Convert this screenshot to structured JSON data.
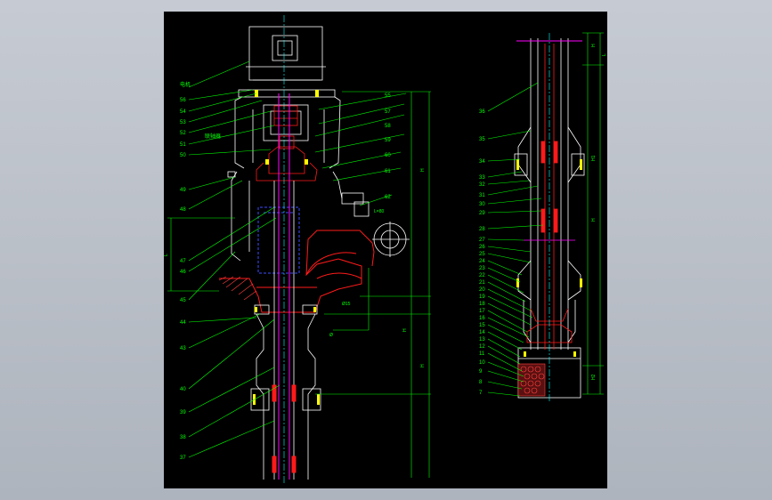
{
  "colors": {
    "background": "#b8bec7",
    "canvas": "#000000",
    "outline": "#ffffff",
    "leader": "#00ff00",
    "section": "#ff1a1a",
    "shaft": "#ff00ff",
    "centerline": "#00ffff",
    "hidden": "#3b4bff",
    "bolt": "#ffff00",
    "hatch": "#ff4040"
  },
  "left_view": {
    "part_labels": [
      "56",
      "54",
      "53",
      "52",
      "51",
      "50",
      "49",
      "48",
      "47",
      "46",
      "45",
      "44",
      "43",
      "40",
      "39",
      "38",
      "37"
    ],
    "side_labels": [
      "55",
      "57",
      "58",
      "59",
      "60",
      "61",
      "62"
    ],
    "motor_tag": "电机",
    "coupling_tag": "联轴器",
    "dimensions": [
      "L",
      "H",
      "Ø",
      "Ø15",
      "L=80"
    ]
  },
  "right_view": {
    "part_labels": [
      "36",
      "35",
      "34",
      "33",
      "32",
      "31",
      "30",
      "29",
      "28",
      "27",
      "26",
      "25",
      "24",
      "23",
      "22",
      "21",
      "20",
      "19",
      "18",
      "17",
      "16",
      "15",
      "14",
      "13",
      "12",
      "11",
      "10",
      "9",
      "8",
      "7"
    ],
    "dimensions": [
      "H",
      "L",
      "H",
      "H1",
      "H2"
    ]
  }
}
